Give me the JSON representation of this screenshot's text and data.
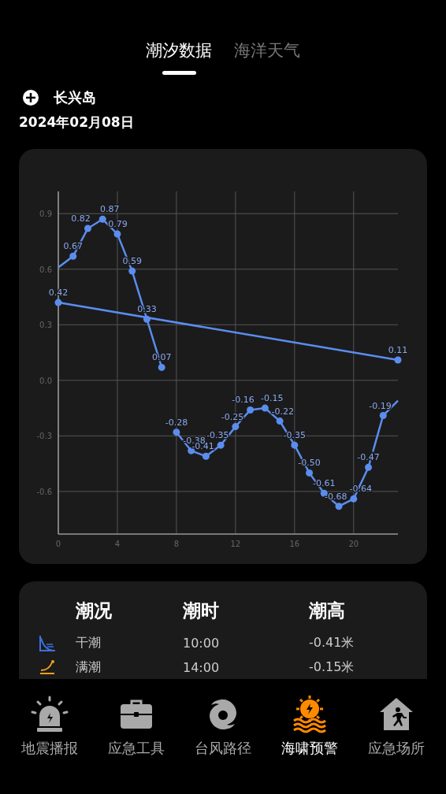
{
  "tabs": [
    {
      "label": "潮汐数据",
      "selected": true
    },
    {
      "label": "海洋天气",
      "selected": false
    }
  ],
  "location": {
    "name": "长兴岛",
    "date": "2024年02月08日"
  },
  "chart_data": {
    "type": "line",
    "grid": true,
    "x": [
      0,
      1,
      2,
      3,
      4,
      5,
      6,
      7,
      8,
      9,
      10,
      11,
      12,
      13,
      14,
      15,
      16,
      17,
      18,
      19,
      20,
      21,
      22,
      23
    ],
    "xlim": [
      0,
      23
    ],
    "ylim": [
      -0.83,
      1.02
    ],
    "xticks": [
      0,
      4,
      8,
      12,
      16,
      20
    ],
    "yticks": [
      {
        "value": 0.9,
        "label": "0.9"
      },
      {
        "value": 0.6,
        "label": "0.6"
      },
      {
        "value": 0.3,
        "label": "0.3"
      },
      {
        "value": 0,
        "label": "0.0"
      },
      {
        "value": -0.3,
        "label": "-0.3"
      },
      {
        "value": -0.6,
        "label": "-0.6"
      }
    ],
    "series": [
      {
        "color": "#5b8def",
        "marker": "circle",
        "values": [
          0.61,
          0.67,
          0.82,
          0.87,
          0.79,
          0.59,
          0.33,
          0.07,
          null,
          null,
          null,
          null,
          null,
          null,
          null,
          null,
          null,
          null,
          null,
          null,
          null,
          null,
          null,
          null
        ],
        "value_labels": [
          null,
          "0.67",
          "0.82",
          "0.87",
          "0.79",
          "0.59",
          "0.33",
          "0.07",
          null,
          null,
          null,
          null,
          null,
          null,
          null,
          null,
          null,
          null,
          null,
          null,
          null,
          null,
          null,
          null
        ]
      },
      {
        "color": "#5b8def",
        "marker": "circle",
        "values": [
          null,
          null,
          null,
          null,
          null,
          null,
          null,
          null,
          -0.28,
          -0.38,
          -0.41,
          -0.35,
          -0.25,
          -0.16,
          -0.15,
          -0.22,
          -0.35,
          -0.5,
          -0.61,
          -0.68,
          -0.64,
          -0.47,
          -0.19,
          -0.11
        ],
        "value_labels": [
          null,
          null,
          null,
          null,
          null,
          null,
          null,
          null,
          "-0.28",
          "-0.38",
          "-0.41",
          "-0.35",
          "-0.25",
          "-0.16",
          "-0.15",
          "-0.22",
          "-0.35",
          "-0.50",
          "-0.61",
          "-0.68",
          "-0.64",
          "-0.47",
          "-0.19",
          null
        ]
      },
      {
        "color": "#5b8def",
        "marker": "circle",
        "values": [
          0.42,
          null,
          null,
          null,
          null,
          null,
          null,
          null,
          null,
          null,
          null,
          null,
          null,
          null,
          null,
          null,
          null,
          null,
          null,
          null,
          null,
          null,
          null,
          0.11
        ],
        "value_labels": [
          "0.42",
          null,
          null,
          null,
          null,
          null,
          null,
          null,
          null,
          null,
          null,
          null,
          null,
          null,
          null,
          null,
          null,
          null,
          null,
          null,
          null,
          null,
          null,
          "0.11"
        ]
      }
    ]
  },
  "table": {
    "columns": [
      "潮况",
      "潮时",
      "潮高"
    ],
    "rows": [
      {
        "kind": "low",
        "state": "干潮",
        "time": "10:00",
        "height": "-0.41米"
      },
      {
        "kind": "high",
        "state": "满潮",
        "time": "14:00",
        "height": "-0.15米"
      }
    ]
  },
  "nav": [
    {
      "kind": "siren",
      "label": "地震播报",
      "selected": false
    },
    {
      "kind": "toolbox",
      "label": "应急工具",
      "selected": false
    },
    {
      "kind": "typhoon",
      "label": "台风路径",
      "selected": false
    },
    {
      "kind": "tsunami",
      "label": "海啸预警",
      "selected": true
    },
    {
      "kind": "shelter",
      "label": "应急场所",
      "selected": false
    }
  ]
}
